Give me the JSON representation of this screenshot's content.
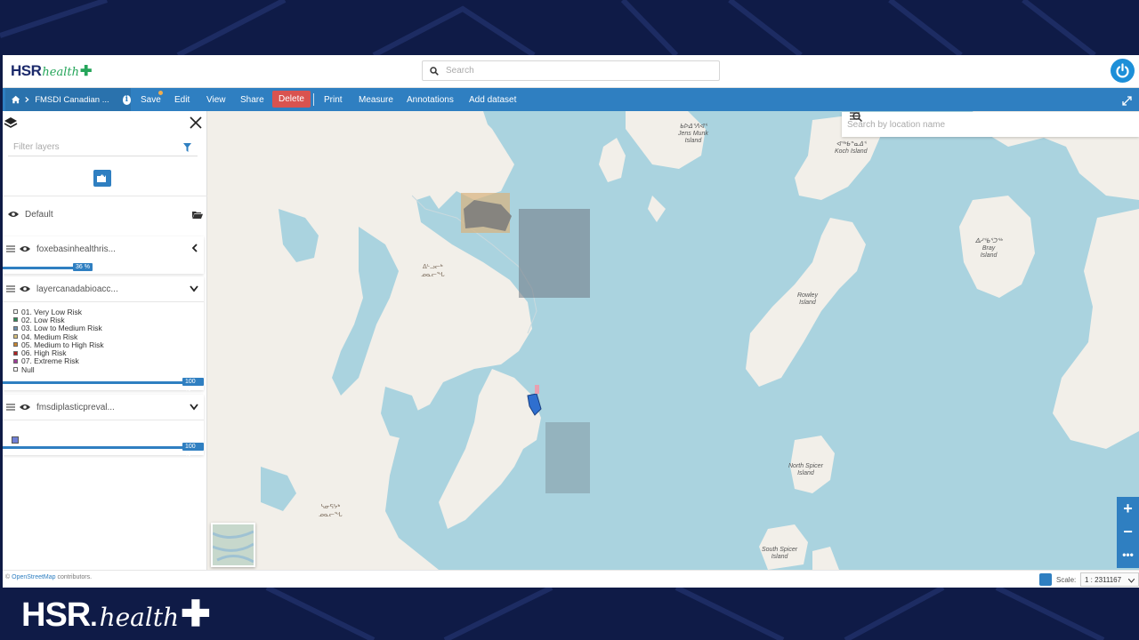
{
  "brand": {
    "hsr": "HSR",
    "health": "health",
    "plus": "✚",
    "big_hsr": "HSR",
    "big_dot": ".",
    "big_health": "health",
    "colors": {
      "navy": "#1c2a6b",
      "green": "#25a55a",
      "toolbar": "#2f7fc1",
      "delete": "#d9534f"
    }
  },
  "header": {
    "search_placeholder": "Search"
  },
  "toolbar": {
    "breadcrumb": "FMSDI Canadian ...",
    "save": "Save",
    "edit": "Edit",
    "view": "View",
    "share": "Share",
    "delete": "Delete",
    "print": "Print",
    "measure": "Measure",
    "annotations": "Annotations",
    "add_dataset": "Add dataset"
  },
  "panel": {
    "filter_placeholder": "Filter layers",
    "group_name": "Default",
    "layers": [
      {
        "name": "foxebasinhealthris...",
        "opacity": "36 %",
        "opacity_value": 0.36,
        "expanded": false
      },
      {
        "name": "layercanadabioacc...",
        "opacity": "100 %",
        "opacity_value": 1.0,
        "expanded": true,
        "legend": [
          {
            "label": "01. Very Low Risk",
            "color": "#ffffff"
          },
          {
            "label": "02. Low Risk",
            "color": "#2e8b57"
          },
          {
            "label": "03. Low to Medium Risk",
            "color": "#6a8fb0"
          },
          {
            "label": "04. Medium Risk",
            "color": "#d9c07a"
          },
          {
            "label": "05. Medium to High Risk",
            "color": "#c9852e"
          },
          {
            "label": "06. High Risk",
            "color": "#b22222"
          },
          {
            "label": "07. Extreme Risk",
            "color": "#a03c9a"
          },
          {
            "label": "Null",
            "color": "#ffffff"
          }
        ]
      },
      {
        "name": "fmsdiplasticpreval...",
        "opacity": "100 %",
        "opacity_value": 1.0,
        "expanded": true,
        "swatch_color": "#6f7fd6"
      }
    ]
  },
  "map": {
    "search_placeholder": "Search by location name",
    "labels": {
      "jens_native": "ᑲᐅᐃᕐᐱᐊᕐ",
      "jens_munk": "Jens Munk",
      "jens_island": "Island",
      "koch_native": "ᐊᖅᑲᓐᓇᐃᕐ",
      "koch": "Koch Island",
      "bray_native": "ᐃᓱᖃᕐᑐᖅ",
      "bray": "Bray",
      "bray_island": "Island",
      "rowley": "Rowley",
      "rowley_island": "Island",
      "north_spicer": "North Spicer",
      "north_spicer_island": "Island",
      "south_spicer": "South Spicer",
      "south_spicer_island": "Island",
      "igloolik_native1": "ᐃᒡᓗᓕᒃ",
      "igloolik_native2": "ᓄᓇᓕᖓ",
      "hall_native1": "ᓴᓂᕋᔭᒃ",
      "hall_native2": "ᓄᓇᓕᖓ"
    }
  },
  "footer": {
    "attribution_symbol": "©",
    "attribution_link": "OpenStreetMap",
    "attribution_rest": " contributors.",
    "scale_label": "Scale:",
    "scale_value": "1 : 2311167"
  }
}
